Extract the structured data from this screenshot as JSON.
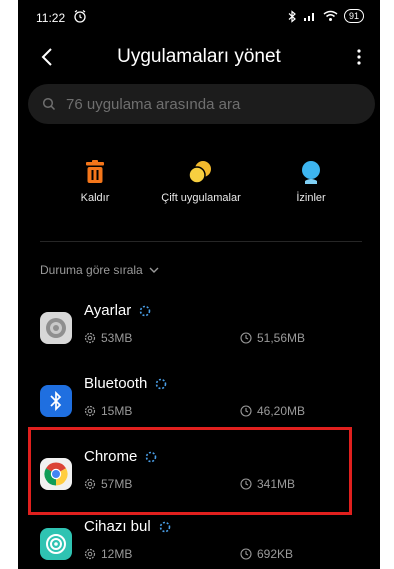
{
  "status": {
    "time": "11:22",
    "battery": "91"
  },
  "header": {
    "title": "Uygulamaları yönet"
  },
  "search": {
    "placeholder": "76 uygulama arasında ara"
  },
  "actions": [
    {
      "label": "Kaldır",
      "icon": "trash-icon"
    },
    {
      "label": "Çift uygulamalar",
      "icon": "dual-apps-icon"
    },
    {
      "label": "İzinler",
      "icon": "permissions-icon"
    }
  ],
  "sort": {
    "label": "Duruma göre sırala"
  },
  "apps": [
    {
      "name": "Ayarlar",
      "size": "53MB",
      "usage": "51,56MB",
      "icon": "settings-app-icon"
    },
    {
      "name": "Bluetooth",
      "size": "15MB",
      "usage": "46,20MB",
      "icon": "bluetooth-app-icon"
    },
    {
      "name": "Chrome",
      "size": "57MB",
      "usage": "341MB",
      "icon": "chrome-app-icon"
    },
    {
      "name": "Cihazı bul",
      "size": "12MB",
      "usage": "692KB",
      "icon": "find-device-app-icon"
    }
  ],
  "colors": {
    "accent": "#f5761a",
    "highlight": "#e0201e",
    "bluetooth": "#1f6fe0",
    "permission": "#3db5f0"
  }
}
